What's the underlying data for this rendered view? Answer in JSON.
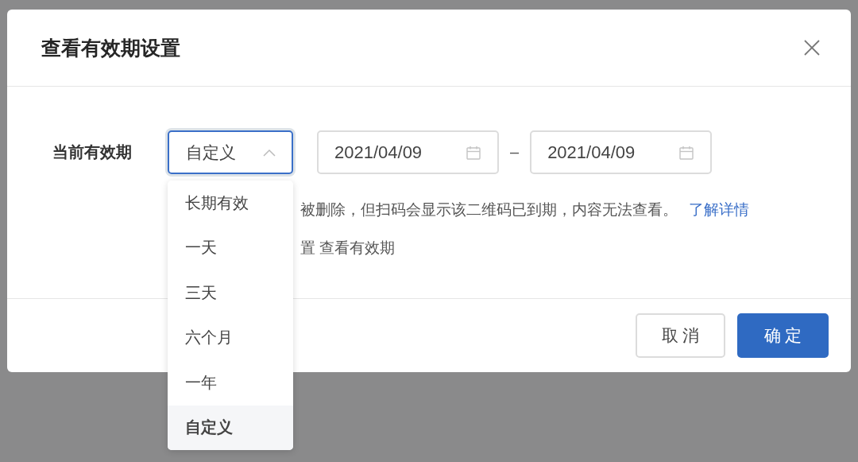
{
  "dialog": {
    "title": "查看有效期设置"
  },
  "form": {
    "label": "当前有效期",
    "select": {
      "value": "自定义",
      "expanded": true,
      "options": [
        {
          "label": "长期有效",
          "selected": false
        },
        {
          "label": "一天",
          "selected": false
        },
        {
          "label": "三天",
          "selected": false
        },
        {
          "label": "六个月",
          "selected": false
        },
        {
          "label": "一年",
          "selected": false
        },
        {
          "label": "自定义",
          "selected": true
        }
      ]
    },
    "start_date": "2021/04/09",
    "separator": "–",
    "end_date": "2021/04/09"
  },
  "hint_lines": [
    {
      "text": "被删除，但扫码会显示该二维码已到期，内容无法查看。",
      "link": "了解详情"
    },
    {
      "text": "置 查看有效期"
    }
  ],
  "buttons": [
    {
      "label": "取 消",
      "kind": "secondary"
    },
    {
      "label": "确 定",
      "kind": "primary"
    }
  ]
}
